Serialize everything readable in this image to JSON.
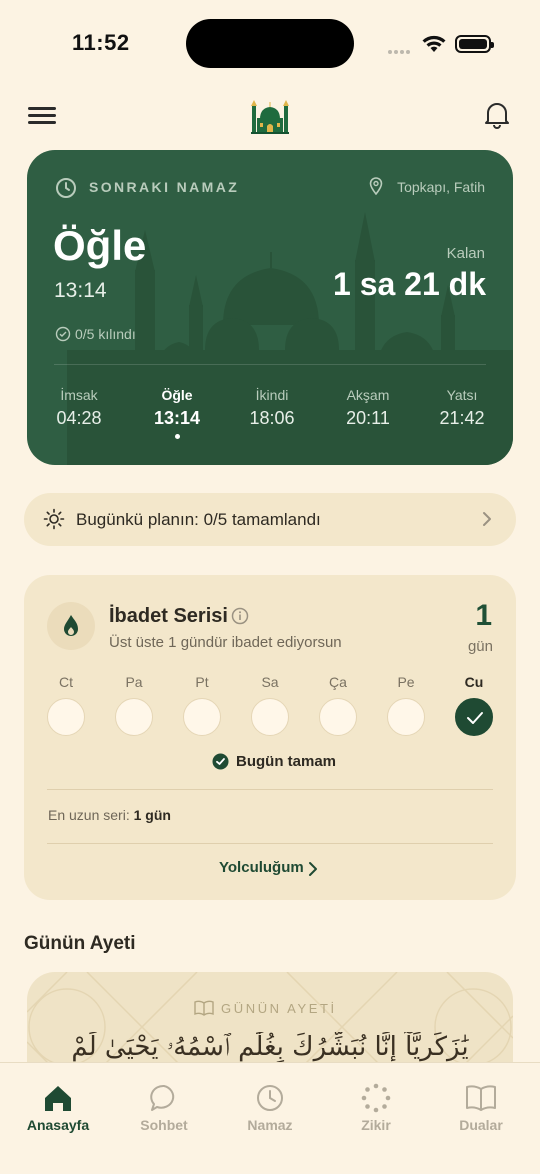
{
  "status_bar": {
    "time": "11:52"
  },
  "prayer_card": {
    "label": "SONRAKI NAMAZ",
    "location": "Topkapı, Fatih",
    "name": "Öğle",
    "time": "13:14",
    "remaining_label": "Kalan",
    "remaining": "1 sa 21 dk",
    "performed": "0/5 kılındı",
    "times": [
      {
        "name": "İmsak",
        "time": "04:28"
      },
      {
        "name": "Öğle",
        "time": "13:14"
      },
      {
        "name": "İkindi",
        "time": "18:06"
      },
      {
        "name": "Akşam",
        "time": "20:11"
      },
      {
        "name": "Yatsı",
        "time": "21:42"
      }
    ]
  },
  "plan": {
    "text": "Bugünkü planın: 0/5 tamamlandı"
  },
  "streak": {
    "title": "İbadet Serisi",
    "subtitle": "Üst üste 1 gündür ibadet ediyorsun",
    "count": "1",
    "unit": "gün",
    "days": [
      "Ct",
      "Pa",
      "Pt",
      "Sa",
      "Ça",
      "Pe",
      "Cu"
    ],
    "today_status": "Bugün tamam",
    "longest_label": "En uzun seri:",
    "longest_value": "1 gün",
    "journey": "Yolculuğum"
  },
  "verse": {
    "heading": "Günün Ayeti",
    "label": "GÜNÜN AYETİ",
    "arabic": "يَٰزَكَرِيَّآ إِنَّا نُبَشِّرُكَ بِغُلَٰمٍ ٱسْمُهُۥ يَحْيَىٰ لَمْ"
  },
  "tabs": [
    {
      "label": "Anasayfa",
      "icon": "home-icon"
    },
    {
      "label": "Sohbet",
      "icon": "chat-icon"
    },
    {
      "label": "Namaz",
      "icon": "clock-icon"
    },
    {
      "label": "Zikir",
      "icon": "prayer-beads-icon"
    },
    {
      "label": "Dualar",
      "icon": "book-icon"
    }
  ],
  "colors": {
    "background": "#fcf3e3",
    "primary_green": "#2f5e43",
    "dark_green": "#1f4a33",
    "card_beige": "#f3e7cb"
  }
}
